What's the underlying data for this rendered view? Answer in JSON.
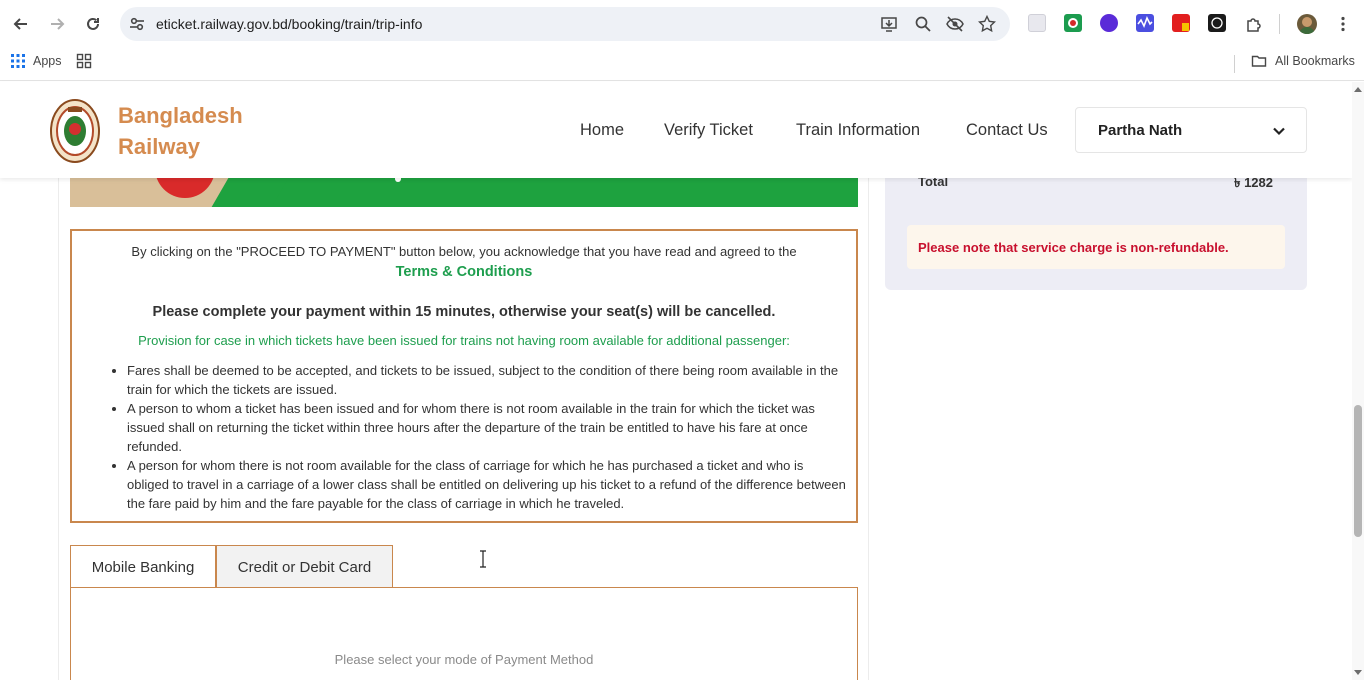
{
  "browser": {
    "url": "eticket.railway.gov.bd/booking/train/trip-info",
    "bookmarks": {
      "apps_label": "Apps",
      "all_bookmarks_label": "All Bookmarks"
    }
  },
  "header": {
    "brand_line1": "Bangladesh",
    "brand_line2": "Railway",
    "menu": [
      "Home",
      "Verify Ticket",
      "Train Information",
      "Contact Us"
    ],
    "user_name": "Partha Nath"
  },
  "summary": {
    "total_label": "Total",
    "total_value": "৳ 1282",
    "note": "Please note that service charge is non-refundable."
  },
  "terms": {
    "intro": "By clicking on the \"PROCEED TO PAYMENT\" button below, you acknowledge that you have read and agreed to the",
    "link": "Terms & Conditions",
    "warning": "Please complete your payment within 15 minutes, otherwise your seat(s) will be cancelled.",
    "provision": "Provision for case in which tickets have been issued for trains not having room available for additional passenger:",
    "rules": [
      "Fares shall be deemed to be accepted, and tickets to be issued, subject to the condition of there being room available in the train for which the tickets are issued.",
      "A person to whom a ticket has been issued and for whom there is not room available in the train for which the ticket was issued shall on returning the ticket within three hours after the departure of the train be entitled to have his fare at once refunded.",
      "A person for whom there is not room available for the class of carriage for which he has purchased a ticket and who is obliged to travel in a carriage of a lower class shall be entitled on delivering up his ticket to a refund of the difference between the fare paid by him and the fare payable for the class of carriage in which he traveled."
    ]
  },
  "payment": {
    "tabs": [
      "Mobile Banking",
      "Credit or Debit Card"
    ],
    "active_tab": "Credit or Debit Card",
    "hint": "Please select your mode of Payment Method"
  },
  "colors": {
    "brand": "#d58b4f",
    "green": "#1e9e4e",
    "border": "#c9874d",
    "alert": "#c8102e"
  }
}
